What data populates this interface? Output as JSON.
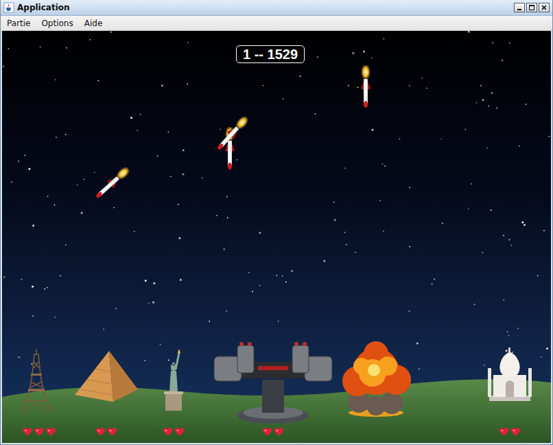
{
  "window": {
    "title": "Application"
  },
  "menu": [
    {
      "label": "Partie"
    },
    {
      "label": "Options"
    },
    {
      "label": "Aide"
    }
  ],
  "score": {
    "text": "1 -- 1529"
  },
  "missiles": [
    {
      "kind": "missile"
    },
    {
      "kind": "missile"
    },
    {
      "kind": "missile"
    },
    {
      "kind": "missile"
    }
  ],
  "monuments": [
    {
      "kind": "eiffel-tower",
      "lives": 3,
      "destroyed": false
    },
    {
      "kind": "pyramid",
      "lives": 2,
      "destroyed": false
    },
    {
      "kind": "statue-of-liberty",
      "lives": 2,
      "destroyed": false
    },
    {
      "kind": "turret",
      "lives": 2,
      "destroyed": false
    },
    {
      "kind": "explosion",
      "lives": 0,
      "destroyed": true
    },
    {
      "kind": "taj-mahal",
      "lives": 2,
      "destroyed": false
    }
  ]
}
